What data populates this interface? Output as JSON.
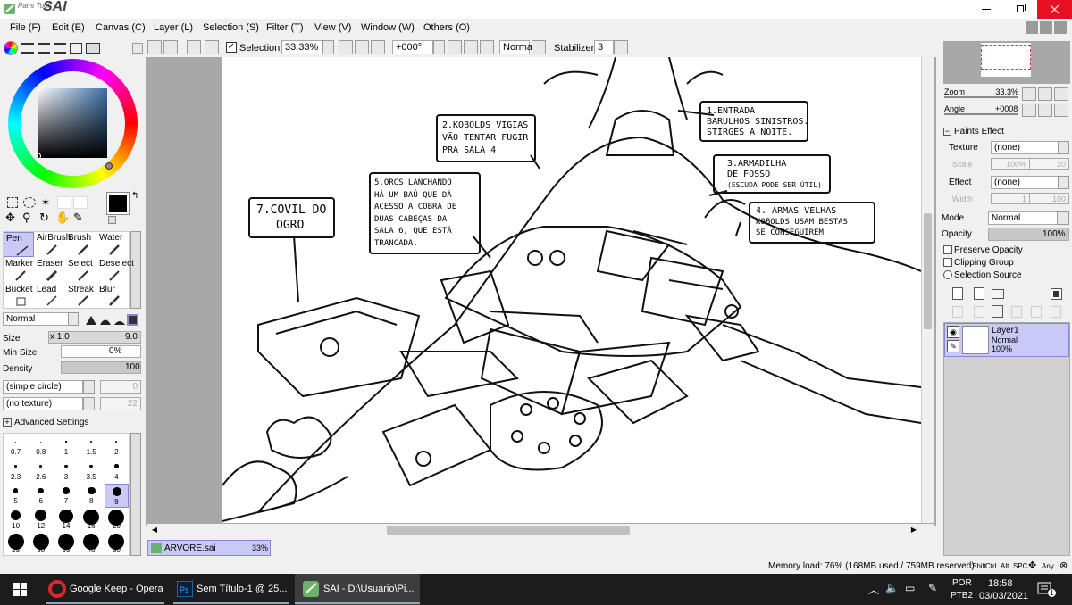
{
  "window": {
    "logo_small": "Paint Tool",
    "logo_big": "SAI"
  },
  "menu": [
    "File (F)",
    "Edit (E)",
    "Canvas (C)",
    "Layer (L)",
    "Selection (S)",
    "Filter (T)",
    "View (V)",
    "Window (W)",
    "Others (O)"
  ],
  "toolbar": {
    "selection_label": "Selection",
    "zoom": "33.33%",
    "rotation": "+000°",
    "blend": "Normal",
    "stabilizer_label": "Stabilizer",
    "stabilizer_value": "3"
  },
  "tools": [
    [
      "Pen",
      "AirBrush",
      "Brush",
      "Water"
    ],
    [
      "Marker",
      "Eraser",
      "Select",
      "Deselect"
    ],
    [
      "Bucket",
      "Lead",
      "Streak",
      "Blur"
    ]
  ],
  "brush": {
    "mode": "Normal",
    "size_label": "Size",
    "size_mult": "x 1.0",
    "size_value": "9.0",
    "minsize_label": "Min Size",
    "minsize_value": "0%",
    "density_label": "Density",
    "density_value": "100",
    "shape": "(simple circle)",
    "shape_value": "0",
    "texture": "(no texture)",
    "texture_value": "22",
    "advanced": "Advanced Settings",
    "size_grid": [
      "0.7",
      "0.8",
      "1",
      "1.5",
      "2",
      "2.3",
      "2.6",
      "3",
      "3.5",
      "4",
      "5",
      "6",
      "7",
      "8",
      "9",
      "10",
      "12",
      "14",
      "16",
      "20",
      "25",
      "30",
      "35",
      "40",
      "50"
    ]
  },
  "navigator": {
    "zoom_label": "Zoom",
    "zoom_value": "33.3%",
    "angle_label": "Angle",
    "angle_value": "+0008"
  },
  "effects": {
    "title": "Paints Effect",
    "texture_label": "Texture",
    "texture_value": "(none)",
    "scale_label": "Scale",
    "scale_value": "100%",
    "scale_num": "20",
    "effect_label": "Effect",
    "effect_value": "(none)",
    "width_label": "Width",
    "width_value": "1",
    "width_num": "100"
  },
  "layer_props": {
    "mode_label": "Mode",
    "mode_value": "Normal",
    "opacity_label": "Opacity",
    "opacity_value": "100%",
    "preserve": "Preserve Opacity",
    "clipping": "Clipping Group",
    "source": "Selection Source"
  },
  "layers": [
    {
      "name": "Layer1",
      "mode": "Normal",
      "opacity": "100%"
    }
  ],
  "canvas_notes": {
    "n1": [
      "1.ENTRADA",
      "BARULHOS SINISTROS.",
      "STIRGES A NOITE."
    ],
    "n2": [
      "2.KOBOLDS VIGIAS",
      "VÃO TENTAR FUGIR",
      "PRA SALA 4"
    ],
    "n3": [
      "3.ARMADILHA",
      "DE FOSSO",
      "(ESCUDA PODE SER ÚTIL)"
    ],
    "n4": [
      "4. ARMAS VELHAS",
      "KOBOLDS USAM BESTAS",
      "SE CONSEGUIREM"
    ],
    "n5": [
      "5.ORCS LANCHANDO",
      "HÁ UM BAÚ QUE DÁ",
      "ACESSO A COBRA DE",
      "DUAS CABEÇAS DA",
      "SALA 6, QUE ESTÁ",
      "TRANCADA."
    ],
    "n7": [
      "7.COVIL DO",
      "OGRO"
    ]
  },
  "doc_tab": {
    "name": "ARVORE.sai",
    "zoom": "33%"
  },
  "status": {
    "memory": "Memory load: 76% (168MB used / 759MB reserved)",
    "keys": [
      "Shift",
      "Ctrl",
      "Alt",
      "SPC"
    ],
    "any": "Any"
  },
  "taskbar": {
    "apps": [
      "Google Keep - Opera",
      "Sem Título-1 @ 25...",
      "SAI - D:\\Usuario\\Pi..."
    ],
    "lang1": "POR",
    "lang2": "PTB2",
    "time": "18:58",
    "date": "03/03/2021",
    "notif": "1"
  },
  "colors": {
    "accent": "#0078d7",
    "taskbar": "#1c1c1c",
    "layer_sel": "#c9c9f5",
    "close_hover": "#e81123"
  }
}
